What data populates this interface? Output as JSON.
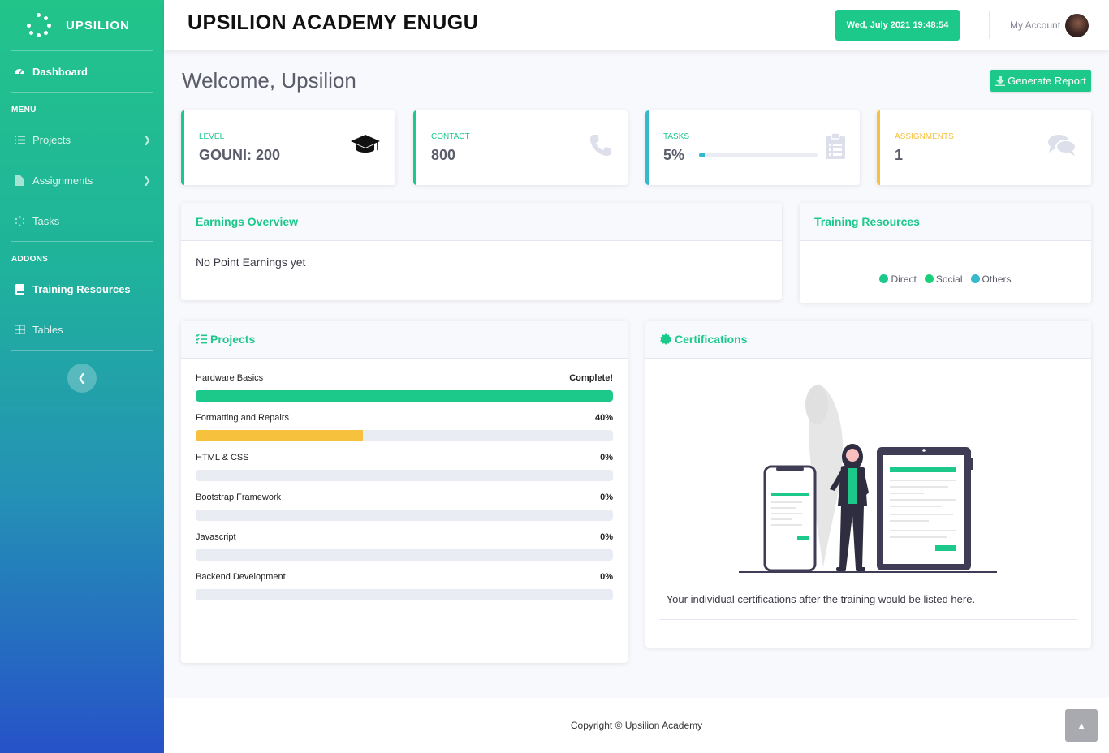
{
  "sidebar": {
    "brand": "UPSILION",
    "dashboard": "Dashboard",
    "menu_heading": "MENU",
    "projects": "Projects",
    "assignments": "Assignments",
    "tasks": "Tasks",
    "addons_heading": "ADDONS",
    "training": "Training Resources",
    "tables": "Tables"
  },
  "topbar": {
    "title": "UPSILION ACADEMY ENUGU",
    "clock": "Wed, July 2021 19:48:54",
    "account": "My Account"
  },
  "page": {
    "welcome": "Welcome, Upsilion",
    "generate_report": "Generate Report"
  },
  "stats": {
    "level": {
      "label": "LEVEL",
      "value": "GOUNI: 200"
    },
    "contact": {
      "label": "CONTACT",
      "value": "800"
    },
    "tasks": {
      "label": "TASKS",
      "value": "5%",
      "progress": 0.05
    },
    "assignments": {
      "label": "ASSIGNMENTS",
      "value": "1"
    }
  },
  "earnings": {
    "title": "Earnings Overview",
    "text": "No Point Earnings yet"
  },
  "training": {
    "title": "Training Resources",
    "legend": [
      {
        "label": "Direct",
        "color": "#1cc88a"
      },
      {
        "label": "Social",
        "color": "#17d07a"
      },
      {
        "label": "Others",
        "color": "#36b9cc"
      }
    ]
  },
  "projects": {
    "title": "Projects",
    "items": [
      {
        "name": "Hardware Basics",
        "status": "Complete!",
        "progress": 1.0,
        "color": "#1cc88a"
      },
      {
        "name": "Formatting and Repairs",
        "status": "40%",
        "progress": 0.4,
        "color": "#f6c23e"
      },
      {
        "name": "HTML & CSS",
        "status": "0%",
        "progress": 0,
        "color": "#1cc88a"
      },
      {
        "name": "Bootstrap Framework",
        "status": "0%",
        "progress": 0,
        "color": "#1cc88a"
      },
      {
        "name": "Javascript",
        "status": "0%",
        "progress": 0,
        "color": "#1cc88a"
      },
      {
        "name": "Backend Development",
        "status": "0%",
        "progress": 0,
        "color": "#1cc88a"
      }
    ]
  },
  "certifications": {
    "title": "Certifications",
    "text": "- Your individual certifications after the training would be listed here."
  },
  "footer": {
    "copyright": "Copyright © Upsilion Academy"
  },
  "colors": {
    "accent": "#1cc88a",
    "info": "#36b9cc",
    "warning": "#f6c23e"
  }
}
